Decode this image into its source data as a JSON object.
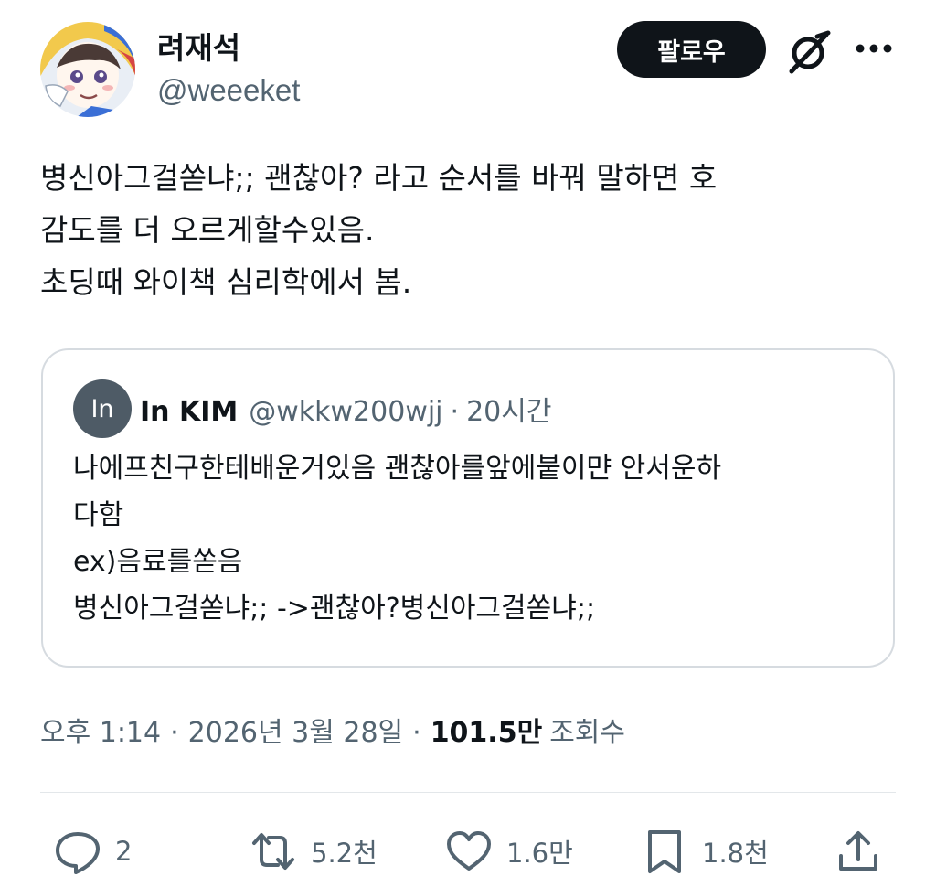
{
  "author": {
    "name": "려재석",
    "handle": "@weeeket",
    "follow_label": "팔로우"
  },
  "tweet": {
    "text": "병신아그걸쏟냐;; 괜찮아? 라고 순서를 바꿔 말하면 호\n감도를 더 오르게할수있음.\n초딩때 와이책 심리학에서 봄."
  },
  "quote": {
    "avatar_initials": "In",
    "name": "In KIM",
    "handle": "@wkkw200wjj",
    "separator": "·",
    "time": "20시간",
    "text": "나에프친구한테배운거있음 괜찮아를앞에붙이먄 안서운하\n다함\nex)음료를쏟음\n병신아그걸쏟냐;; ->괜찮아?병신아그걸쏟냐;;"
  },
  "meta": {
    "time": "오후 1:14",
    "date": "2026년 3월 28일",
    "separator": "·",
    "views_count": "101.5만",
    "views_label": "조회수"
  },
  "actions": {
    "replies": "2",
    "reposts": "5.2천",
    "likes": "1.6만",
    "bookmarks": "1.8천"
  },
  "icons": {
    "avatar": "avatar-illustration",
    "grok": "grok-icon",
    "more": "more-icon",
    "reply": "reply-icon",
    "repost": "repost-icon",
    "like": "heart-icon",
    "bookmark": "bookmark-icon",
    "share": "share-icon"
  },
  "colors": {
    "text_primary": "#0f1419",
    "text_secondary": "#536471",
    "border": "#d6dbe0",
    "button_bg": "#0f1419"
  }
}
